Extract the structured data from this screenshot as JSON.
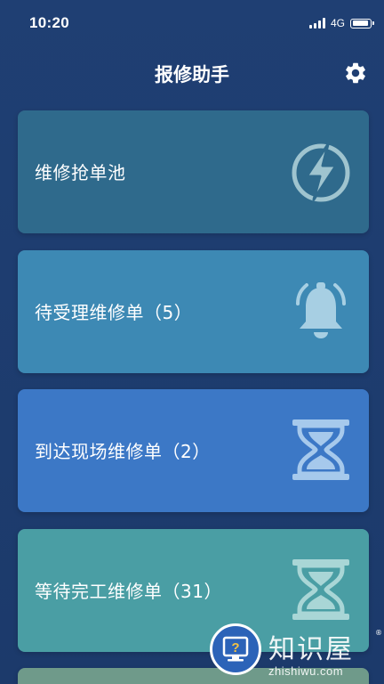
{
  "status_bar": {
    "time": "10:20",
    "network": "4G"
  },
  "header": {
    "title": "报修助手"
  },
  "cards": [
    {
      "label": "维修抢单池",
      "color": "#2f6a8c",
      "icon": "lightning-icon"
    },
    {
      "label": "待受理维修单（5）",
      "color": "#3d89b4",
      "icon": "bell-icon"
    },
    {
      "label": "到达现场维修单（2）",
      "color": "#3c78c6",
      "icon": "hourglass-icon"
    },
    {
      "label": "等待完工维修单（31）",
      "color": "#4a9ea4",
      "icon": "hourglass-icon"
    }
  ],
  "watermark": {
    "brand": "知识屋",
    "url": "zhishiwu.com",
    "registered": "®"
  }
}
